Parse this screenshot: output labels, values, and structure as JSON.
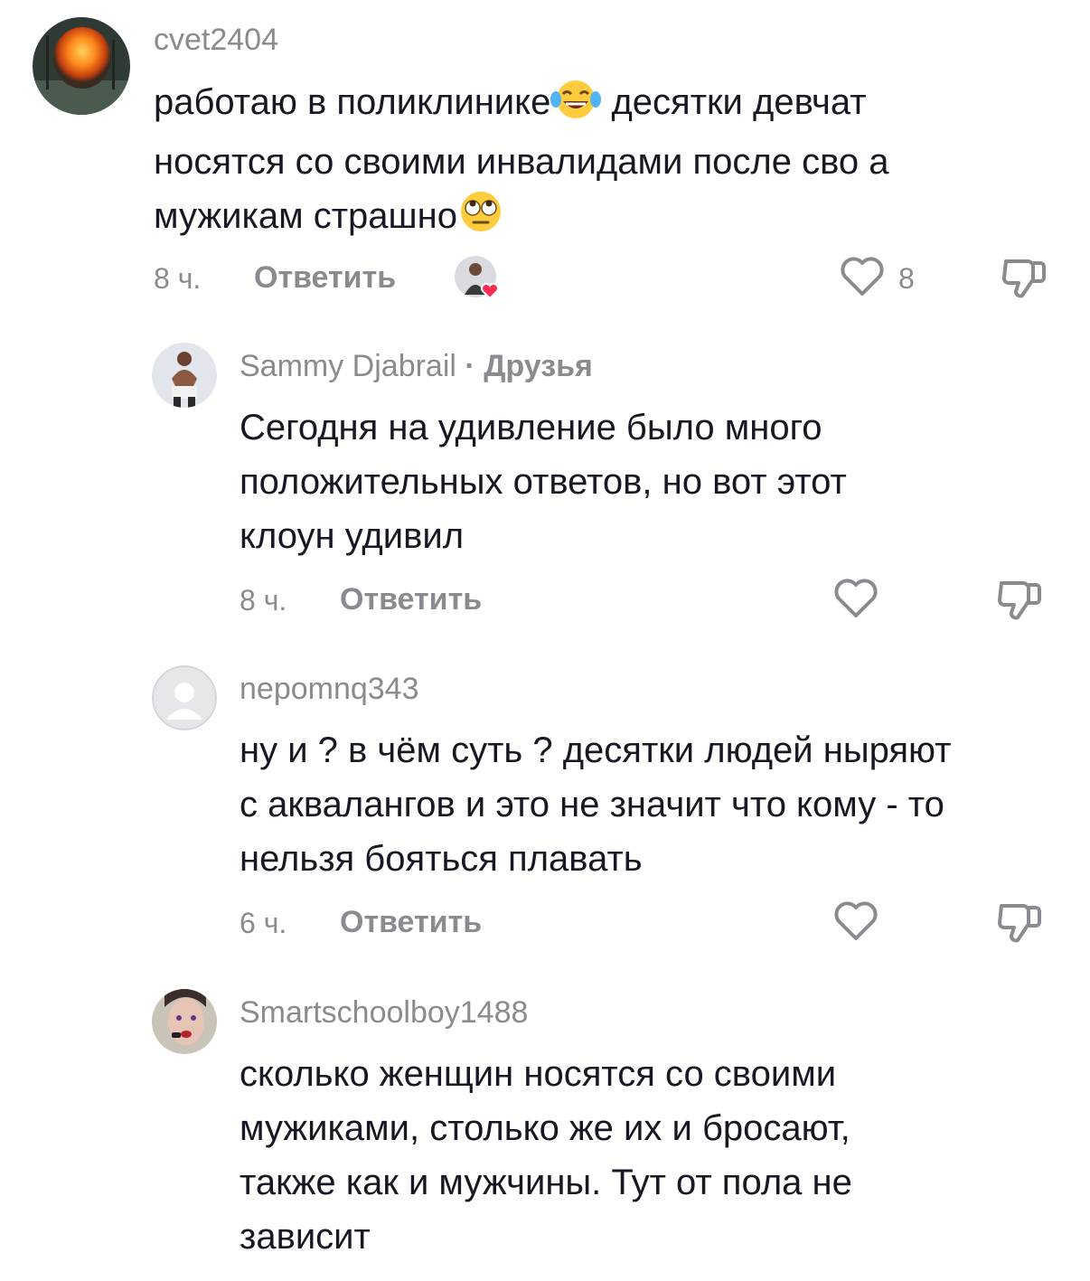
{
  "comments": [
    {
      "username": "cvet2404",
      "lines": [
        "работаю в поликлинике",
        "десятки девчат",
        "носятся со своими инвалидами после сво а",
        "мужикам страшно"
      ],
      "emoji_1": "tears-of-joy-emoji",
      "emoji_2": "rolling-eyes-emoji",
      "time": "8 ч.",
      "reply_label": "Ответить",
      "likes": "8"
    },
    {
      "username": "Sammy Djabrail",
      "separator": "·",
      "badge": "Друзья",
      "lines": [
        "Сегодня на удивление было много",
        "положительных ответов, но вот этот",
        "клоун удивил"
      ],
      "time": "8 ч.",
      "reply_label": "Ответить"
    },
    {
      "username": "nepomnq343",
      "lines": [
        "ну и ? в чём суть ? десятки людей ныряют",
        "с аквалангов и это не значит что кому - то",
        "нельзя бояться плавать"
      ],
      "time": "6 ч.",
      "reply_label": "Ответить"
    },
    {
      "username": "Smartschoolboy1488",
      "lines": [
        "сколько женщин носятся со своими",
        "мужиками, столько же их и бросают,",
        "также как и мужчины. Тут от пола не",
        "зависит"
      ]
    }
  ],
  "colors": {
    "text": "#161823",
    "muted": "#8a8b91",
    "heart_badge": "#fe2c55"
  },
  "icons": {
    "like": "heart-outline-icon",
    "dislike": "thumbs-down-icon",
    "default_avatar": "default-avatar-icon"
  }
}
